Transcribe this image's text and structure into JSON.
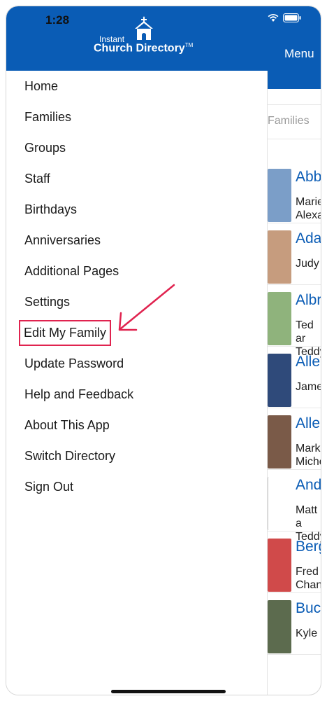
{
  "status_bar": {
    "time": "1:28"
  },
  "logo": {
    "small": "Instant",
    "big": "Church Directory",
    "tm": "TM"
  },
  "background": {
    "menu_label": "Menu",
    "breadcrumb": "Families",
    "families": [
      {
        "name": "Abbo",
        "members": "Marie\nAlexan",
        "photo_color": "#7b9ec8"
      },
      {
        "name": "Adai",
        "members": "Judy",
        "photo_color": "#c69c7e"
      },
      {
        "name": "Albri",
        "members": "Ted ar\nTeddy",
        "photo_color": "#8fb37c"
      },
      {
        "name": "Allen",
        "members": "James",
        "photo_color": "#2f4a7a"
      },
      {
        "name": "Allen",
        "members": "Mark\nMiche",
        "photo_color": "#7a5a48"
      },
      {
        "name": "Ande",
        "members": "Matt a\nTeddy",
        "photo_color": "#ffffff"
      },
      {
        "name": "Berg",
        "members": "Fred a\nChanc",
        "photo_color": "#d04a4a"
      },
      {
        "name": "Buck",
        "members": "Kyle",
        "photo_color": "#5c6b4e"
      }
    ]
  },
  "menu": {
    "items": [
      {
        "label": "Home",
        "name": "menu-item-home"
      },
      {
        "label": "Families",
        "name": "menu-item-families"
      },
      {
        "label": "Groups",
        "name": "menu-item-groups"
      },
      {
        "label": "Staff",
        "name": "menu-item-staff"
      },
      {
        "label": "Birthdays",
        "name": "menu-item-birthdays"
      },
      {
        "label": "Anniversaries",
        "name": "menu-item-anniversaries"
      },
      {
        "label": "Additional Pages",
        "name": "menu-item-additional-pages"
      },
      {
        "label": "Settings",
        "name": "menu-item-settings"
      },
      {
        "label": "Edit My Family",
        "name": "menu-item-edit-my-family"
      },
      {
        "label": "Update Password",
        "name": "menu-item-update-password"
      },
      {
        "label": "Help and Feedback",
        "name": "menu-item-help-feedback"
      },
      {
        "label": "About This App",
        "name": "menu-item-about"
      },
      {
        "label": "Switch Directory",
        "name": "menu-item-switch-directory"
      },
      {
        "label": "Sign Out",
        "name": "menu-item-sign-out"
      }
    ]
  },
  "colors": {
    "brand_blue": "#0a5cb5",
    "highlight_red": "#e0234f"
  }
}
